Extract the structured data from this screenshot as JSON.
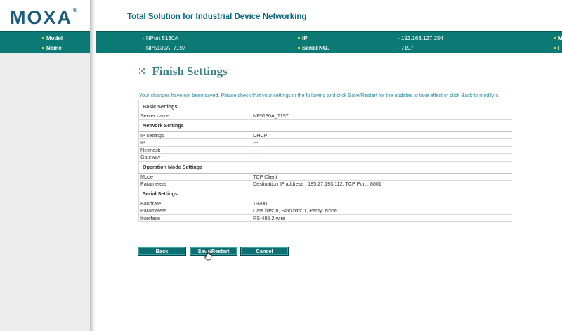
{
  "header": {
    "logo": "MOXA",
    "logo_mark": "®",
    "tagline": "Total Solution for Industrial Device Networking"
  },
  "infobar": {
    "model_key": "Model",
    "model_value": "- NPort 5130A",
    "name_key": "Name",
    "name_value": "- NP5130A_7197",
    "ip_key": "IP",
    "ip_value": "- 192.168.127.254",
    "serial_key": "Serial NO.",
    "serial_value": "- 7197",
    "cut_right_1": "M",
    "cut_right_2": "F"
  },
  "main": {
    "title": "Finish Settings",
    "notice": "Your changes have not been saved. Please check that your settings in the following and click Save/Restart for the updates to take effect or click Back to modify it.",
    "sections": [
      {
        "title": "Basic Settings",
        "rows": [
          {
            "label": "Server name",
            "value": "NP5130A_7197"
          }
        ]
      },
      {
        "title": "Network Settings",
        "rows": [
          {
            "label": "IP settings",
            "value": "DHCP"
          },
          {
            "label": "IP",
            "value": "---"
          },
          {
            "label": "Netmask",
            "value": "---"
          },
          {
            "label": "Gateway",
            "value": "---"
          }
        ]
      },
      {
        "title": "Operation Mode Settings",
        "rows": [
          {
            "label": "Mode",
            "value": "TCP Client"
          },
          {
            "label": "Parameters",
            "value": "Destination IP address : 185.27.193.112, TCP Port : 8001"
          }
        ]
      },
      {
        "title": "Serial Settings",
        "rows": [
          {
            "label": "Baudrate",
            "value": "19200"
          },
          {
            "label": "Parameters",
            "value": "Data bits: 8, Stop bits: 1, Parity: None"
          },
          {
            "label": "Interface",
            "value": "RS-485 2-wire"
          }
        ]
      }
    ],
    "buttons": {
      "back": "Back",
      "save_restart": "Save/Restart",
      "cancel": "Cancel"
    }
  },
  "colors": {
    "brand": "#1a5c79",
    "infobar": "#0c7a74",
    "title": "#3a7f86",
    "notice": "#2a8aa0",
    "button": "#0c6f73"
  },
  "icons": {
    "title_bullet": "dots-icon",
    "cursor": "hand-pointer-icon"
  }
}
